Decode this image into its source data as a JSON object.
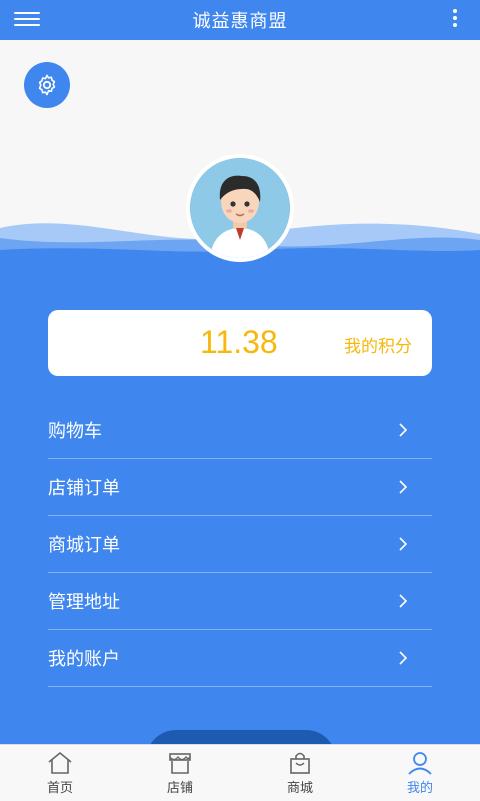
{
  "header": {
    "title": "诚益惠商盟"
  },
  "points": {
    "value": "11.38",
    "label": "我的积分"
  },
  "menu": [
    {
      "label": "购物车"
    },
    {
      "label": "店铺订单"
    },
    {
      "label": "商城订单"
    },
    {
      "label": "管理地址"
    },
    {
      "label": "我的账户"
    }
  ],
  "tabs": [
    {
      "label": "首页",
      "icon": "home-icon"
    },
    {
      "label": "店铺",
      "icon": "store-icon"
    },
    {
      "label": "商城",
      "icon": "bag-icon"
    },
    {
      "label": "我的",
      "icon": "user-icon"
    }
  ],
  "colors": {
    "primary": "#3f87ee",
    "points": "#f5b80b"
  }
}
